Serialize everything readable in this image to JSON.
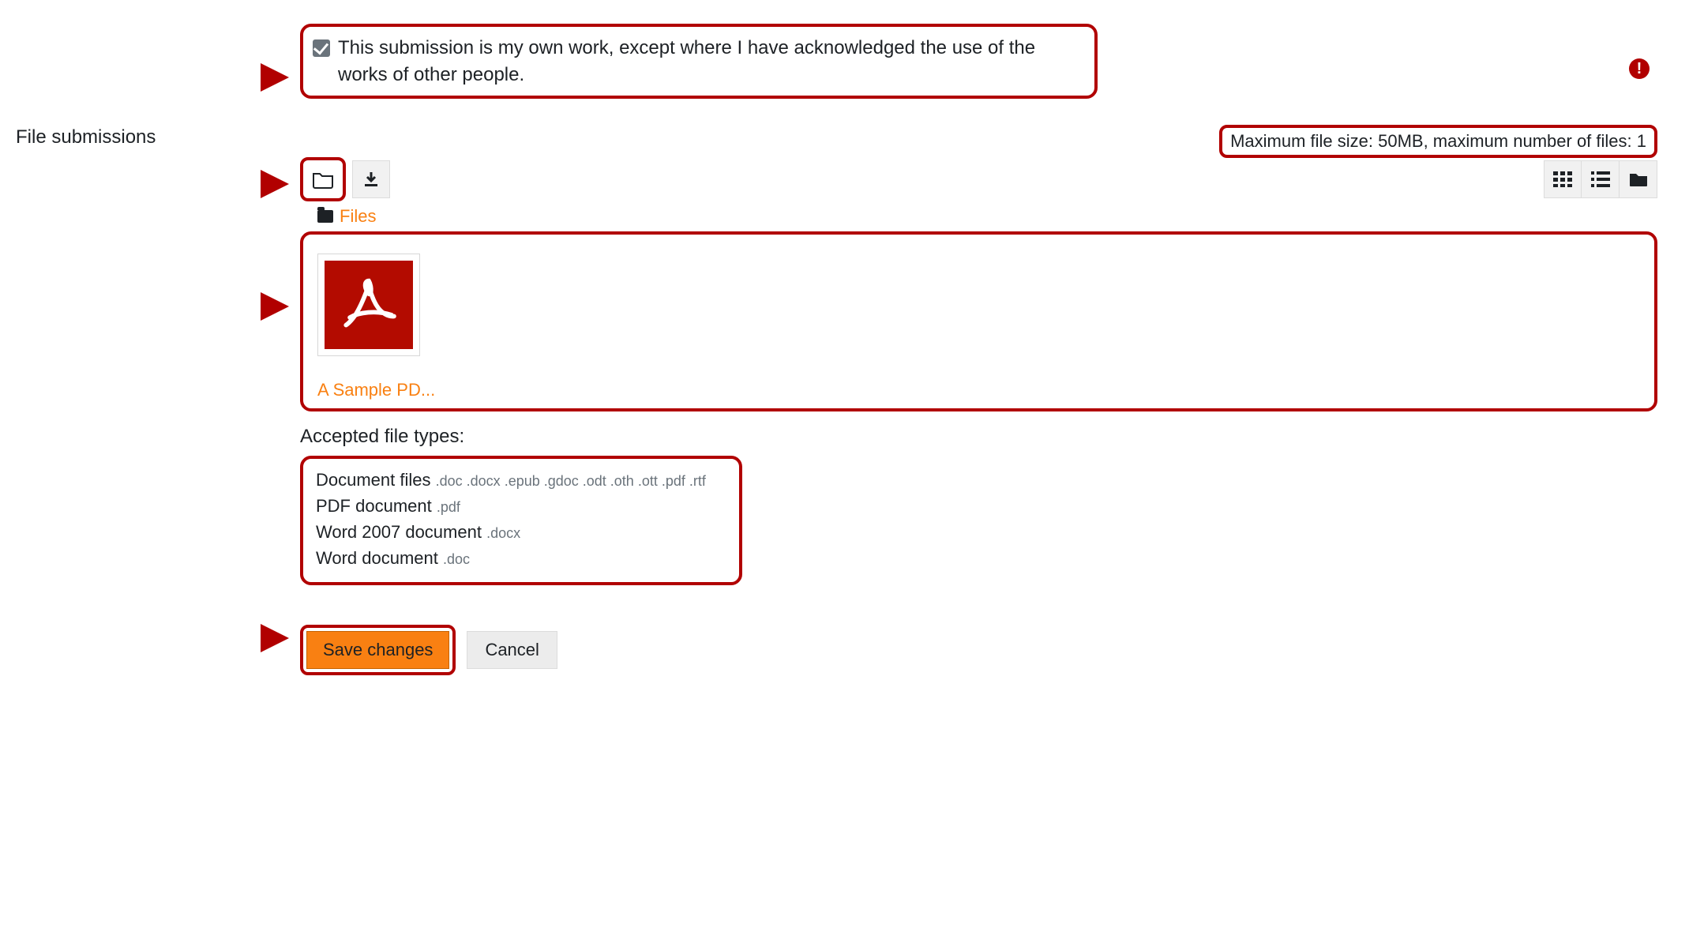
{
  "declaration": {
    "checked": true,
    "text": "This submission is my own work, except where I have acknowledged the use of the works of other people."
  },
  "section_label": "File submissions",
  "limits_text": "Maximum file size: 50MB, maximum number of files: 1",
  "breadcrumb": {
    "root": "Files"
  },
  "file": {
    "name": "A Sample PD..."
  },
  "accepted": {
    "label": "Accepted file types:",
    "types": [
      {
        "label": "Document files",
        "ext": ".doc .docx .epub .gdoc .odt .oth .ott .pdf .rtf"
      },
      {
        "label": "PDF document",
        "ext": ".pdf"
      },
      {
        "label": "Word 2007 document",
        "ext": ".docx"
      },
      {
        "label": "Word document",
        "ext": ".doc"
      }
    ]
  },
  "buttons": {
    "save": "Save changes",
    "cancel": "Cancel"
  }
}
